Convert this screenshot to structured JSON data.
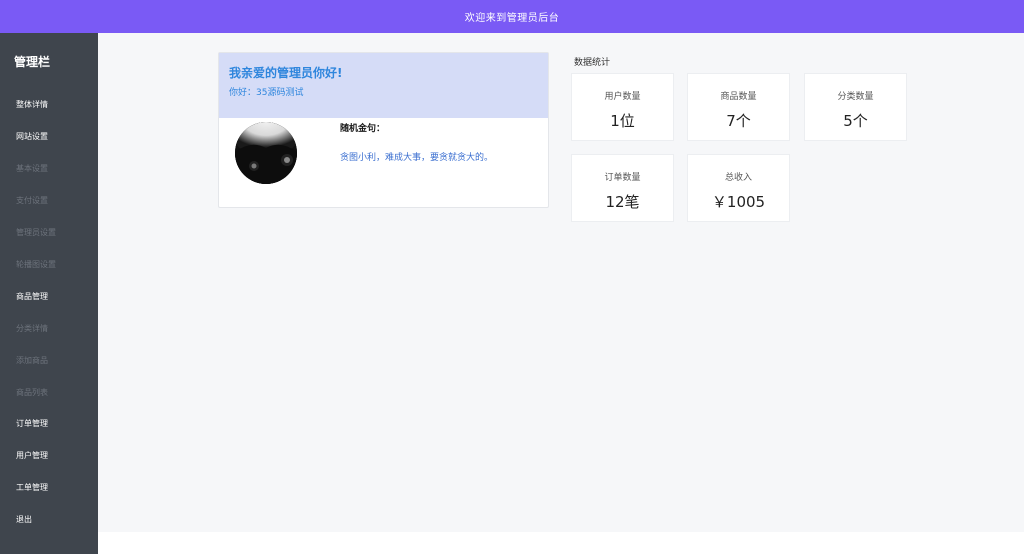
{
  "header": {
    "title": "欢迎来到管理员后台"
  },
  "sidebar": {
    "brand": "管理栏",
    "items": [
      {
        "label": "整体详情",
        "type": "main"
      },
      {
        "label": "网站设置",
        "type": "main"
      },
      {
        "label": "基本设置",
        "type": "sub"
      },
      {
        "label": "支付设置",
        "type": "sub"
      },
      {
        "label": "管理员设置",
        "type": "sub"
      },
      {
        "label": "轮播图设置",
        "type": "sub"
      },
      {
        "label": "商品管理",
        "type": "main"
      },
      {
        "label": "分类详情",
        "type": "sub"
      },
      {
        "label": "添加商品",
        "type": "sub"
      },
      {
        "label": "商品列表",
        "type": "sub"
      },
      {
        "label": "订单管理",
        "type": "main"
      },
      {
        "label": "用户管理",
        "type": "main"
      },
      {
        "label": "工单管理",
        "type": "main"
      },
      {
        "label": "退出",
        "type": "main"
      }
    ]
  },
  "welcome": {
    "title": "我亲爱的管理员你好!",
    "subtitle": "你好：35源码测试",
    "quote_label": "随机金句：",
    "quote_text": "贪图小利，难成大事，要贪就贪大的。"
  },
  "stats": {
    "title": "数据统计",
    "cards": [
      {
        "label": "用户数量",
        "value": "1位"
      },
      {
        "label": "商品数量",
        "value": "7个"
      },
      {
        "label": "分类数量",
        "value": "5个"
      },
      {
        "label": "订单数量",
        "value": "12笔"
      },
      {
        "label": "总收入",
        "value": "￥1005"
      }
    ]
  },
  "colors": {
    "topbar": "#7a5af5",
    "sidebar": "#3f454d",
    "accent_blue": "#2f86dd"
  }
}
